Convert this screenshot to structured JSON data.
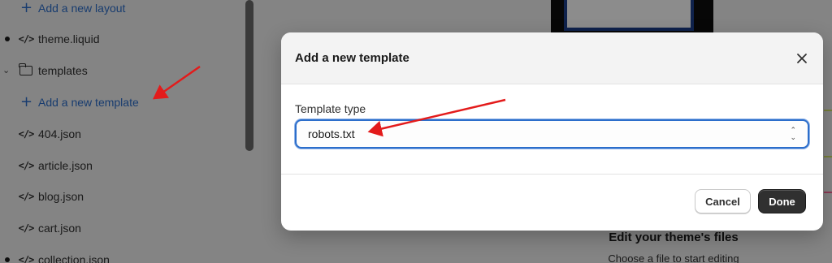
{
  "sidebar": {
    "items": [
      {
        "type": "link",
        "icon": "plus-icon",
        "label": "Add a new layout"
      },
      {
        "type": "file",
        "icon": "code-icon",
        "label": "theme.liquid",
        "modified": true
      },
      {
        "type": "folder",
        "icon": "folder-icon",
        "label": "templates",
        "expanded": true
      },
      {
        "type": "link",
        "icon": "plus-icon",
        "label": "Add a new template"
      },
      {
        "type": "file",
        "icon": "code-icon",
        "label": "404.json"
      },
      {
        "type": "file",
        "icon": "code-icon",
        "label": "article.json"
      },
      {
        "type": "file",
        "icon": "code-icon",
        "label": "blog.json"
      },
      {
        "type": "file",
        "icon": "code-icon",
        "label": "cart.json"
      },
      {
        "type": "file",
        "icon": "code-icon",
        "label": "collection.json",
        "modified": true
      }
    ]
  },
  "preview": {
    "empty_title": "Edit your theme's files",
    "empty_subtitle": "Choose a file to start editing"
  },
  "modal": {
    "title": "Add a new template",
    "field_label": "Template type",
    "select_value": "robots.txt",
    "cancel_label": "Cancel",
    "done_label": "Done"
  },
  "colors": {
    "link": "#2c6ecb",
    "annotation_arrow": "#e31b1b",
    "primary_button": "#303030"
  }
}
